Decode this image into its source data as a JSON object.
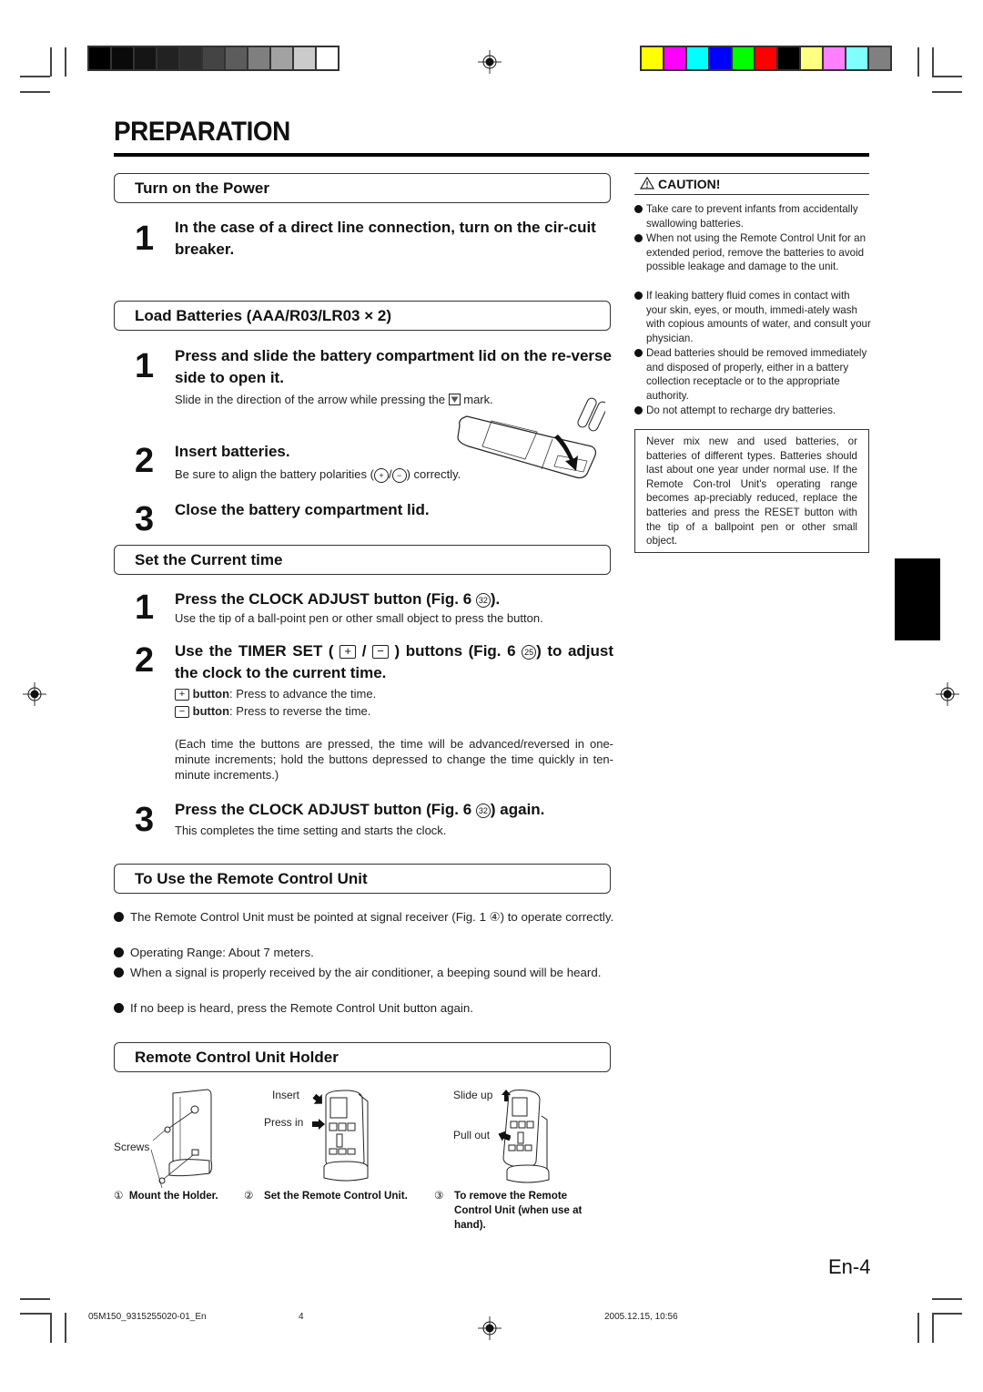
{
  "page": {
    "title": "PREPARATION",
    "page_label": "En-4"
  },
  "print_marks": {
    "gray_swatches": [
      "#000000",
      "#0a0a0a",
      "#151515",
      "#222222",
      "#2d2d2d",
      "#444444",
      "#5c5c5c",
      "#7f7f7f",
      "#a2a2a2",
      "#cbcbcb",
      "#ffffff"
    ],
    "color_swatches": [
      "#ffff00",
      "#ff00ff",
      "#00ffff",
      "#0000ff",
      "#00ff00",
      "#ff0000",
      "#000000",
      "#ffff80",
      "#ff80ff",
      "#80ffff",
      "#808080"
    ]
  },
  "sections": {
    "power": {
      "heading": "Turn on the Power",
      "steps": [
        {
          "num": "1",
          "text": "In the case of a direct line connection, turn on the cir-cuit breaker."
        }
      ]
    },
    "batteries": {
      "heading": "Load Batteries (AAA/R03/LR03 × 2)",
      "steps": [
        {
          "num": "1",
          "text": "Press and slide the battery compartment lid on the re-verse side to open it.",
          "note_before": "Slide in the direction of the arrow while pressing the",
          "note_after": "mark."
        },
        {
          "num": "2",
          "text": "Insert batteries.",
          "note_before": "Be sure to align the battery polarities (",
          "note_mid": "/",
          "note_after": ") correctly."
        },
        {
          "num": "3",
          "text": "Close the battery compartment lid."
        }
      ]
    },
    "time": {
      "heading": "Set the Current time",
      "steps": [
        {
          "num": "1",
          "text_a": "Press the CLOCK ADJUST button (Fig. 6 ",
          "ref": "32",
          "text_b": ").",
          "note": "Use the tip of a ball-point pen or other small object to press the button."
        },
        {
          "num": "2",
          "text_a": "Use the TIMER SET ( ",
          "plus": "+",
          "slash": " / ",
          "minus": "−",
          "text_b": " ) buttons (Fig. 6 ",
          "ref": "25",
          "text_c": ") to adjust the clock to the current time.",
          "plus_label": "button",
          "plus_desc": ": Press to advance the time.",
          "minus_label": "button",
          "minus_desc": ": Press to reverse the time.",
          "extra": "(Each time the buttons are pressed, the time will be advanced/reversed in one-minute increments; hold the buttons depressed to change the time quickly in ten-minute increments.)"
        },
        {
          "num": "3",
          "text_a": "Press the CLOCK ADJUST button  (Fig. 6 ",
          "ref": "32",
          "text_b": ") again.",
          "note": "This completes the time setting and starts the clock."
        }
      ]
    },
    "remote": {
      "heading": "To Use the Remote Control Unit",
      "bullets": [
        "The Remote Control Unit must be pointed at signal receiver (Fig. 1 ④) to operate correctly.",
        "Operating Range: About 7 meters.",
        "When a signal is properly received by the air conditioner, a beeping sound will be heard.",
        "If no beep is heard, press the Remote Control Unit button again."
      ]
    },
    "holder": {
      "heading": "Remote Control Unit Holder",
      "labels": {
        "screws": "Screws",
        "insert": "Insert",
        "press_in": "Press in",
        "slide_up": "Slide up",
        "pull_out": "Pull out"
      },
      "captions": [
        {
          "num": "①",
          "text": "Mount the Holder."
        },
        {
          "num": "②",
          "text": "Set the Remote Control Unit."
        },
        {
          "num": "③",
          "text": "To remove the Remote Control Unit (when use at hand)."
        }
      ]
    }
  },
  "caution": {
    "heading": "CAUTION!",
    "bullets": [
      "Take care to prevent infants from accidentally swallowing batteries.",
      "When not using the Remote Control Unit for an extended period, remove the batteries to avoid possible leakage and damage to the unit.",
      "If leaking battery fluid comes in contact with your skin, eyes, or mouth, immedi-ately wash with copious amounts of water, and consult your physician.",
      "Dead batteries should be removed immediately and disposed of properly, either in a battery collection receptacle or to the appropriate authority.",
      "Do not attempt to recharge dry batteries."
    ],
    "box_text": "Never mix new and used batteries, or batteries of different types. Batteries should last about one year under normal use. If the Remote Con-trol Unit's operating range becomes ap-preciably reduced, replace the batteries and press the RESET button with the tip of a ballpoint pen or other small object."
  },
  "footer": {
    "file": "05M150_9315255020-01_En",
    "page": "4",
    "timestamp": "2005.12.15, 10:56"
  }
}
